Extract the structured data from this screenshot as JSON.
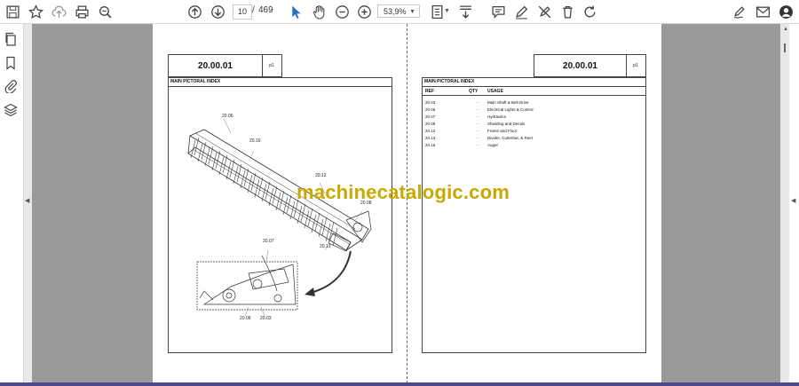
{
  "toolbar": {
    "page_current": "10",
    "page_separator": "/",
    "page_total": "469",
    "zoom": "53,9%"
  },
  "left_page": {
    "section_number": "20.00.01",
    "page_label": "p1",
    "title": "MAIN PICTORAL INDEX",
    "callouts": [
      "20.06",
      "20.16",
      "20.12",
      "20.08",
      "20.13",
      "20.07",
      "20.06",
      "20.03"
    ]
  },
  "right_page": {
    "section_number": "20.00.01",
    "page_label": "p1",
    "title": "MAIN PICTORAL INDEX",
    "columns": [
      "REF",
      "QTY",
      "USAGE"
    ],
    "rows": [
      {
        "ref": "20.03",
        "qty": "-",
        "usage": "Main Shaft & Belt Drive"
      },
      {
        "ref": "20.06",
        "qty": "-",
        "usage": "Electrical Lights & Control"
      },
      {
        "ref": "20.07",
        "qty": "-",
        "usage": "Hydraulics"
      },
      {
        "ref": "20.08",
        "qty": "-",
        "usage": "Shielding and Decals"
      },
      {
        "ref": "20.12",
        "qty": "-",
        "usage": "Frame and Floor"
      },
      {
        "ref": "20.13",
        "qty": "-",
        "usage": "Divider, Cutterbar, & Reel"
      },
      {
        "ref": "20.16",
        "qty": "-",
        "usage": "Auger"
      }
    ]
  },
  "watermark": "machinecatalogic.com",
  "icons": {
    "left_toolbar": [
      "save-icon",
      "star-icon",
      "upload-icon",
      "print-icon",
      "zoom-icon"
    ],
    "center_toolbar": [
      "page-up-icon",
      "page-down-icon",
      "cursor-icon",
      "hand-icon",
      "zoom-out-icon",
      "zoom-in-icon",
      "fit-page-icon",
      "scroll-icon",
      "comment-icon",
      "pen-icon",
      "erase-icon",
      "delete-icon",
      "rotate-icon"
    ],
    "right_toolbar": [
      "sign-icon",
      "mail-icon",
      "account-icon"
    ],
    "left_panel": [
      "copy-icon",
      "bookmark-icon",
      "attachment-icon",
      "layers-icon"
    ]
  }
}
